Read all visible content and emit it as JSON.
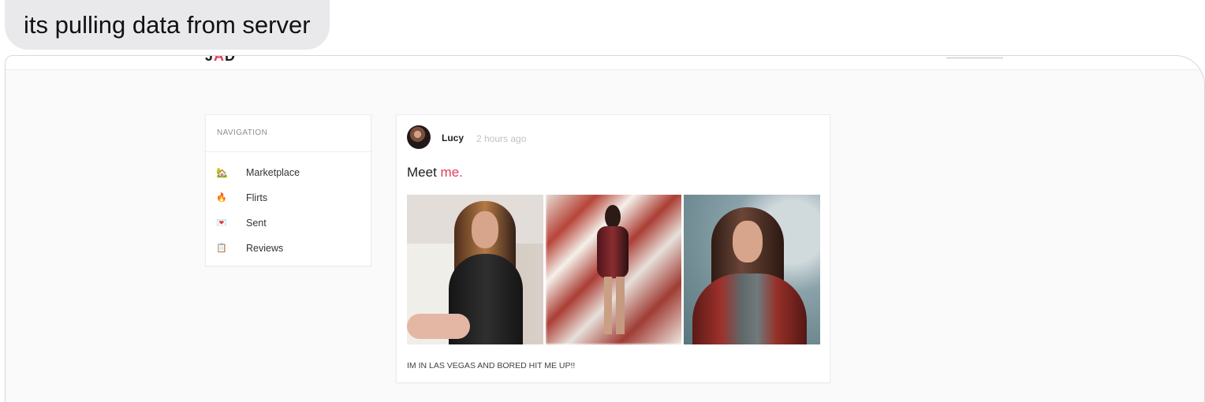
{
  "message": {
    "text": "its pulling data from server"
  },
  "app": {
    "logo_left": "J",
    "logo_accent": "A",
    "logo_right": "D"
  },
  "navigation": {
    "heading": "NAVIGATION",
    "items": [
      {
        "label": "Marketplace",
        "icon": "🏡",
        "icon_name": "house-icon"
      },
      {
        "label": "Flirts",
        "icon": "🔥",
        "icon_name": "fire-icon"
      },
      {
        "label": "Sent",
        "icon": "💌",
        "icon_name": "heart-mail-icon"
      },
      {
        "label": "Reviews",
        "icon": "📋",
        "icon_name": "clipboard-icon"
      }
    ]
  },
  "post": {
    "author": "Lucy",
    "time": "2 hours ago",
    "heading_prefix": "Meet",
    "heading_accent": "me.",
    "caption": "IM IN LAS VEGAS AND BORED HIT ME UP!!"
  },
  "colors": {
    "accent": "#e03b5c",
    "background": "#fafafa",
    "card": "#ffffff"
  }
}
